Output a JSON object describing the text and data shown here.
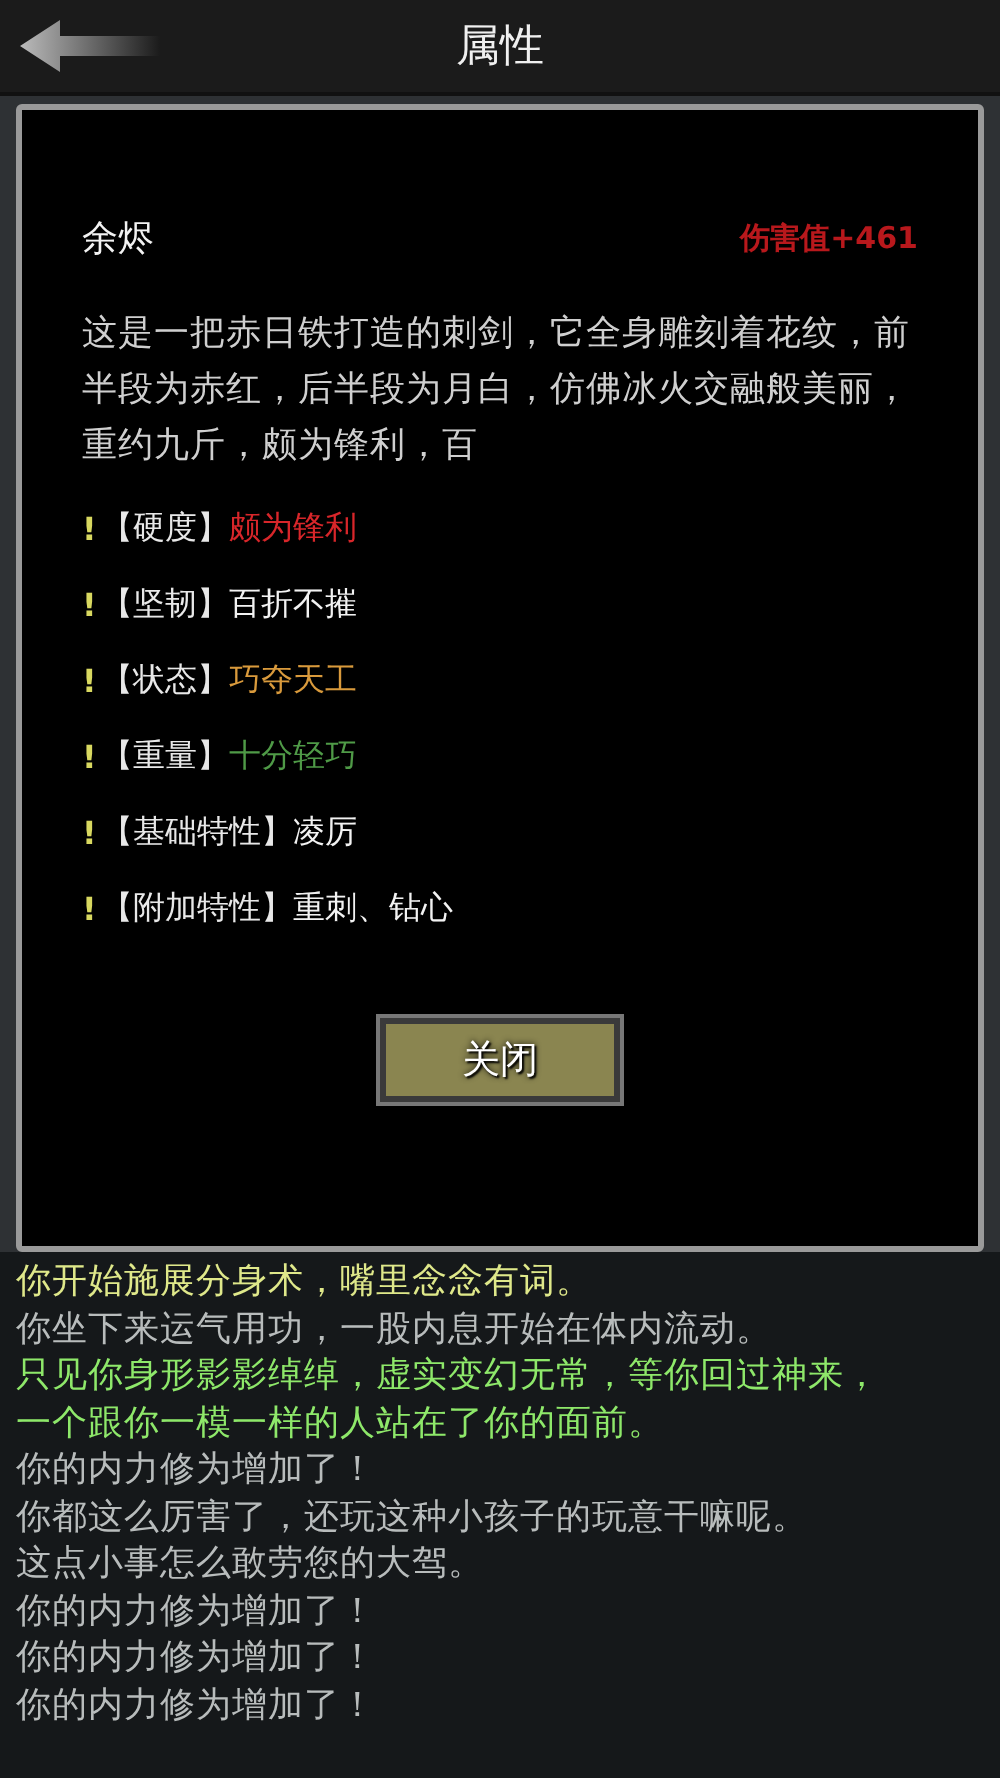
{
  "header": {
    "title": "属性"
  },
  "item": {
    "name": "余烬",
    "damage": "伤害值+461",
    "description": "这是一把赤日铁打造的刺剑，它全身雕刻着花纹，前半段为赤红，后半段为月白，仿佛冰火交融般美丽，重约九斤，颇为锋利，百"
  },
  "attributes": [
    {
      "mark": "!",
      "label": "【硬度】",
      "value": "颇为锋利",
      "color": "#d8262a"
    },
    {
      "mark": "!",
      "label": "【坚韧】",
      "value": "百折不摧",
      "color": "#f2f2f2"
    },
    {
      "mark": "!",
      "label": "【状态】",
      "value": "巧夺天工",
      "color": "#d99a3c"
    },
    {
      "mark": "!",
      "label": "【重量】",
      "value": "十分轻巧",
      "color": "#4f9a47"
    },
    {
      "mark": "!",
      "label": "【基础特性】",
      "value": "凌厉",
      "color": "#f2f2f2"
    },
    {
      "mark": "!",
      "label": "【附加特性】",
      "value": "重刺、钻心",
      "color": "#f2f2f2"
    }
  ],
  "close_button": "关闭",
  "log": [
    {
      "text": "你开始施展分身术，嘴里念念有词。",
      "color": "#dfe88a"
    },
    {
      "text": "你坐下来运气用功，一股内息开始在体内流动。",
      "color": "#b8bcbc"
    },
    {
      "text": "只见你身形影影绰绰，虚实变幻无常，等你回过神来，",
      "color": "#8ee86a"
    },
    {
      "text": "一个跟你一模一样的人站在了你的面前。",
      "color": "#8ee86a"
    },
    {
      "text": "你的内力修为增加了！",
      "color": "#b8bcbc"
    },
    {
      "text": "你都这么厉害了，还玩这种小孩子的玩意干嘛呢。",
      "color": "#b8bcbc"
    },
    {
      "text": "这点小事怎么敢劳您的大驾。",
      "color": "#b8bcbc"
    },
    {
      "text": "你的内力修为增加了！",
      "color": "#b8bcbc"
    },
    {
      "text": "你的内力修为增加了！",
      "color": "#b8bcbc"
    },
    {
      "text": "你的内力修为增加了！",
      "color": "#b8bcbc"
    }
  ]
}
